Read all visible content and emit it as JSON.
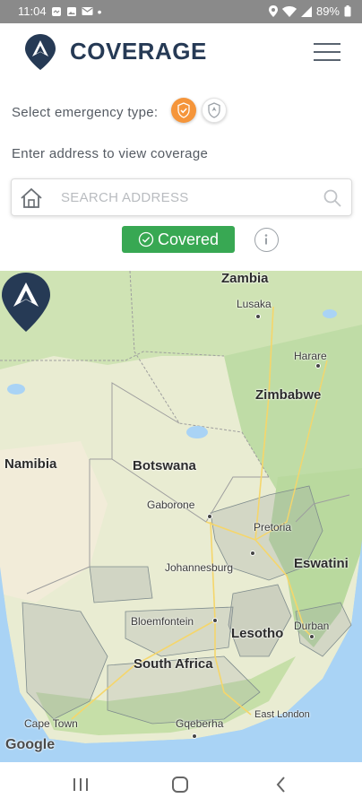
{
  "status_bar": {
    "time": "11:04",
    "battery": "89%",
    "icons": [
      "messenger-icon",
      "gallery-icon",
      "gmail-icon",
      "dot-icon",
      "location-icon",
      "wifi-icon",
      "signal-icon",
      "battery-icon"
    ]
  },
  "header": {
    "title": "COVERAGE",
    "logo_icon": "brand-pin-logo",
    "menu_icon": "hamburger-menu-icon"
  },
  "emergency": {
    "label": "Select emergency type:",
    "options": [
      {
        "name": "fire-icon",
        "selected": true,
        "color": "#f5953a"
      },
      {
        "name": "shield-icon",
        "selected": false,
        "color": "#ffffff"
      }
    ]
  },
  "address": {
    "hint": "Enter address to view coverage",
    "placeholder": "SEARCH ADDRESS",
    "value": ""
  },
  "coverage": {
    "status": "Covered",
    "status_color": "#38a853"
  },
  "map": {
    "countries": [
      "Zambia",
      "Zimbabwe",
      "Namibia",
      "Botswana",
      "Eswatini",
      "Lesotho",
      "South Africa"
    ],
    "cities": [
      "Lusaka",
      "Harare",
      "Gaborone",
      "Pretoria",
      "Johannesburg",
      "Bloemfontein",
      "Durban",
      "Cape Town",
      "Gqeberha",
      "East London"
    ],
    "attribution": "Google"
  },
  "colors": {
    "brand": "#263a55",
    "accent": "#f5953a",
    "covered": "#38a853"
  }
}
